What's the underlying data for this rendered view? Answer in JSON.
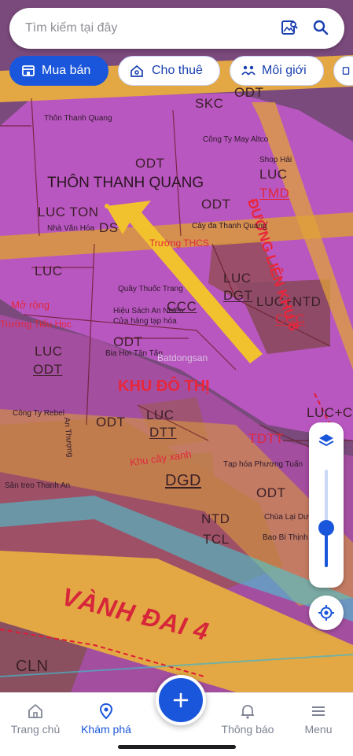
{
  "search": {
    "placeholder": "Tìm kiếm tại đây"
  },
  "chips": [
    {
      "label": "Mua bán",
      "active": true
    },
    {
      "label": "Cho thuê",
      "active": false
    },
    {
      "label": "Môi giới",
      "active": false
    }
  ],
  "map": {
    "zones": {
      "skc": "SKC",
      "odt_top": "ODT",
      "odt_1": "ODT",
      "odt_2": "ODT",
      "odt_3": "ODT",
      "odt_4": "ODT",
      "odt_5": "ODT",
      "odt_6": "ODT",
      "luc_tmd": "LUC",
      "tmd": "TMD",
      "luc_ton": "LUC TON",
      "ds": "DS",
      "luc_a": "LUC",
      "luc_odt": "LUC",
      "odt_under": "ODT",
      "luc_dgt": "LUC",
      "dgt": "DGT",
      "ccc_a": "CCC",
      "luc_ntd": "LUC+NTD",
      "ccc_b": "CCC",
      "luc_dtt": "LUC",
      "dtt": "DTT",
      "dgd": "DGD",
      "luc_c": "LUC+C",
      "tdtt": "TDTT",
      "cln": "CLN",
      "ntd_small": "NTD",
      "tcl": "TCL"
    },
    "labels": {
      "thon_thanh_quang": "THÔN THANH QUANG",
      "khu_do_thi": "KHU ĐÔ THỊ",
      "duong_lien_khu_8": "ĐƯỜNG LIÊN KHU 8",
      "vanh_dai_4": "VÀNH ĐAI 4",
      "khu_cay_xanh": "Khu cây xanh",
      "thon_thanh_quang_small": "Thôn Thanh Quang",
      "cong_ty_my_altco": "Công Ty May Altco",
      "shop_hai": "Shop Hải",
      "cay_da": "Cây đa Thanh Quang",
      "truong_thcs": "Trường THCS",
      "truong_tieu_hoc": "Trường Tiểu Học",
      "nha_van_hoa": "Nhà Văn Hóa",
      "quay_thuoc": "Quầy Thuốc Trang",
      "hieu_sach": "Hiệu Sách An Nhiên",
      "cua_hang_tap_hoa": "Cửa hàng tạp hóa",
      "bia_hoi": "Bia Hơi Tân Tân",
      "batdongsan": "Batdongsan",
      "cong_ty_rebel": "Công Ty Rebel",
      "tap_hoa_phuong_tuan": "Tạp hóa Phương Tuấn",
      "chua_lai_du": "Chùa Lại Dư",
      "bao_bi": "Bao Bì Thịnh",
      "san_treo": "Sân treo Thanh An",
      "an_thuong": "An Thượng",
      "mo_rong": "Mở rộng"
    }
  },
  "nav": [
    {
      "label": "Trang chủ",
      "icon": "home-icon",
      "active": false
    },
    {
      "label": "Khám phá",
      "icon": "map-pin-icon",
      "active": true
    },
    {
      "label": "Thông báo",
      "icon": "bell-icon",
      "active": false
    },
    {
      "label": "Menu",
      "icon": "menu-icon",
      "active": false
    }
  ],
  "colors": {
    "accent": "#1a56db",
    "urban_land": "#b154b8",
    "road": "#e0a93c",
    "rice_land": "#a05a68",
    "arrow": "#f2c12e"
  },
  "zoom_level": 0.4
}
